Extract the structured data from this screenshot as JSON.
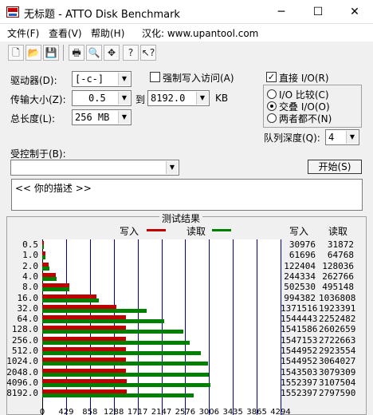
{
  "window": {
    "title": "无标题 - ATTO Disk Benchmark",
    "minimize": "─",
    "maximize": "☐",
    "close": "✕"
  },
  "menu": [
    "文件(F)",
    "查看(V)",
    "帮助(H)",
    "汉化: www.upantool.com"
  ],
  "toolbar": [
    {
      "name": "new-file-icon",
      "glyph": "🗋"
    },
    {
      "name": "open-folder-icon",
      "glyph": "📂"
    },
    {
      "name": "save-icon",
      "glyph": "💾"
    },
    {
      "name": "print-icon",
      "glyph": "🖶"
    },
    {
      "name": "print-preview-icon",
      "glyph": "🔍"
    },
    {
      "name": "move-icon",
      "glyph": "✥"
    },
    {
      "name": "help-icon",
      "glyph": "?"
    },
    {
      "name": "context-help-icon",
      "glyph": "↖?"
    }
  ],
  "settings": {
    "drive_label": "驱动器(D):",
    "drive_value": "[-c-]",
    "force_write_label": "强制写入访问(A)",
    "force_write_checked": false,
    "transfer_label": "传输大小(Z):",
    "transfer_from": "0.5",
    "transfer_to_label": "到",
    "transfer_to": "8192.0",
    "transfer_unit": "KB",
    "length_label": "总长度(L):",
    "length_value": "256 MB",
    "direct_io_label": "直接 I/O(R)",
    "direct_io_checked": true,
    "io_compare_label": "I/O 比较(C)",
    "overlapped_io_label": "交叠 I/O(O)",
    "neither_label": "两者都不(N)",
    "queue_label": "队列深度(Q):",
    "queue_value": "4",
    "controlled_by_label": "受控制于(B):",
    "controlled_by_value": "",
    "start_button": "开始(S)",
    "description": "<<   你的描述    >>"
  },
  "results": {
    "title": "测试结果",
    "legend_write": "写入",
    "legend_read": "读取",
    "col_write": "写入",
    "col_read": "读取"
  },
  "chart_data": {
    "type": "bar",
    "orientation": "horizontal",
    "title": "测试结果",
    "categories": [
      "0.5",
      "1.0",
      "2.0",
      "4.0",
      "8.0",
      "16.0",
      "32.0",
      "64.0",
      "128.0",
      "256.0",
      "512.0",
      "1024.0",
      "2048.0",
      "4096.0",
      "8192.0"
    ],
    "series": [
      {
        "name": "写入",
        "color": "#c00000",
        "values": [
          30976,
          61696,
          122404,
          244334,
          502530,
          994382,
          1371516,
          1544443,
          1541586,
          1547153,
          1544952,
          1544952,
          1543503,
          1552397,
          1552397
        ]
      },
      {
        "name": "读取",
        "color": "#008000",
        "values": [
          31872,
          64768,
          128036,
          262766,
          495148,
          1036808,
          1923391,
          2252482,
          2602659,
          2722663,
          2923554,
          3064027,
          3079309,
          3107504,
          2797590
        ]
      }
    ],
    "xticks": [
      "0",
      "429",
      "858",
      "1288",
      "1717",
      "2147",
      "2576",
      "3006",
      "3435",
      "3865",
      "4294"
    ],
    "xlim": [
      0,
      4294
    ],
    "x_units_per_value": 1024
  }
}
